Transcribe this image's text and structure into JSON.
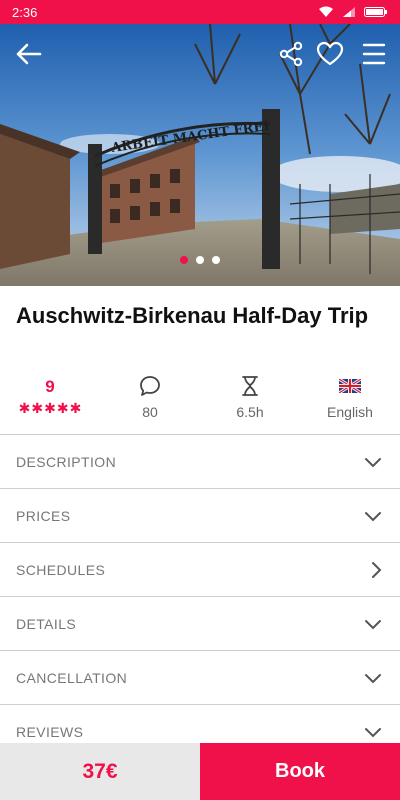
{
  "status_bar": {
    "time": "2:36"
  },
  "hero": {
    "gate_sign": "ARBEIT MACHT FREI",
    "carousel_total": 3,
    "carousel_active": 1
  },
  "tour": {
    "title": "Auschwitz-Birkenau Half-Day Trip"
  },
  "stats": {
    "rating": "9",
    "stars": 5,
    "reviews_count": "80",
    "duration": "6.5h",
    "language": "English"
  },
  "sections": [
    {
      "label": "DESCRIPTION",
      "icon": "chevron-down"
    },
    {
      "label": "PRICES",
      "icon": "chevron-down"
    },
    {
      "label": "SCHEDULES",
      "icon": "chevron-right"
    },
    {
      "label": "DETAILS",
      "icon": "chevron-down"
    },
    {
      "label": "CANCELLATION",
      "icon": "chevron-down"
    },
    {
      "label": "REVIEWS",
      "icon": "chevron-down"
    }
  ],
  "booking": {
    "price": "37€",
    "book_label": "Book"
  },
  "colors": {
    "accent": "#f0104a",
    "price_bg": "#e8e8e8"
  }
}
